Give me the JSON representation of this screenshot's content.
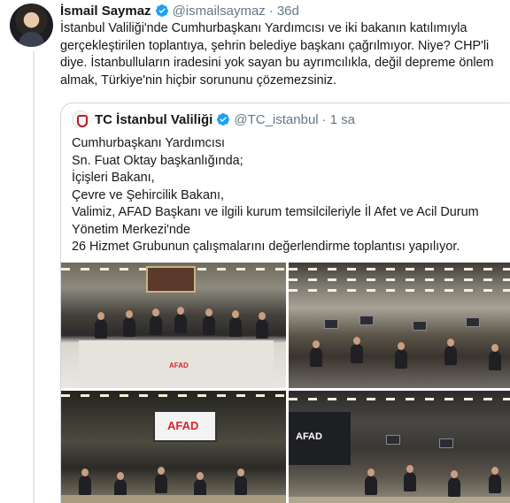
{
  "tweet": {
    "author_name": "İsmail Saymaz",
    "author_handle": "@ismailsaymaz",
    "separator": "·",
    "time": "36d",
    "text": "İstanbul Valiliği'nde Cumhurbaşkanı Yardımcısı ve iki bakanın katılımıyla\ngerçekleştirilen toplantıya, şehrin belediye başkanı çağrılmıyor. Niye? CHP'li\ndiye. İstanbulluların iradesini yok sayan bu ayrımcılıkla, değil depreme önlem\nalmak, Türkiye'nin hiçbir sorununu çözemezsiniz."
  },
  "quoted_tweet": {
    "author_name": "TC İstanbul Valiliği",
    "author_handle": "@TC_istanbul",
    "separator": "·",
    "time": "1 sa",
    "text": "Cumhurbaşkanı Yardımcısı\nSn. Fuat Oktay başkanlığında;\nİçişleri Bakanı,\nÇevre ve Şehircilik Bakanı,\nValimiz, AFAD Başkanı ve ilgili kurum temsilcileriyle İl Afet ve Acil Durum\nYönetim Merkezi'nde\n26 Hizmet Grubunun çalışmalarını değerlendirme toplantısı yapılıyor.",
    "photos": {
      "photo3_screen_label": "AFAD",
      "photo4_wall_label": "AFAD",
      "photo1_podium_label": "AFAD"
    }
  },
  "colors": {
    "verified_blue": "#1da1f2",
    "secondary_text": "#657786",
    "border": "#ccd6dd",
    "afad_red": "#d7262f"
  },
  "icons": {
    "verified": "verified-badge-icon"
  }
}
